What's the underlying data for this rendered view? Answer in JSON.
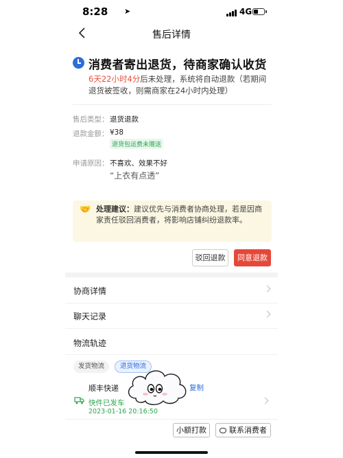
{
  "status_bar": {
    "time": "8:28",
    "network": "4G"
  },
  "nav": {
    "title": "售后详情"
  },
  "status_header": {
    "headline": "消费者寄出退货，待商家确认收货",
    "deadline_highlight": "6天22小时4分",
    "deadline_rest": "后未处理，系统将自动退款（若期间退货被签收，则需商家在24小时内处理）"
  },
  "details": {
    "type_label": "售后类型：",
    "type_value": "退货退款",
    "amount_label": "退款金额：",
    "amount_value": "¥38",
    "amount_tag": "退货包运费未赠送",
    "reason_label": "申请原因：",
    "reason_value": "不喜欢、效果不好",
    "reason_quote": "“上衣有点透”"
  },
  "suggestion": {
    "prefix": "处理建议：",
    "text": "建议优先与消费者协商处理，若是因商家责任驳回消费者，将影响店铺纠纷退款率。"
  },
  "actions": {
    "reject": "驳回退款",
    "agree": "同意退款"
  },
  "sections": {
    "negotiation": "协商详情",
    "chat": "聊天记录"
  },
  "logistics": {
    "title": "物流轨迹",
    "tab_send": "发货物流",
    "tab_return": "退货物流",
    "courier": "顺丰快递",
    "copy": "复制",
    "status": "快件已发车",
    "time": "2023-01-16 20:16:50"
  },
  "footer": {
    "small_payment": "小额打款",
    "contact": "联系消费者"
  },
  "colors": {
    "accent_red": "#e5483a",
    "accent_blue": "#2d6dd6",
    "success_green": "#2ea44f"
  }
}
